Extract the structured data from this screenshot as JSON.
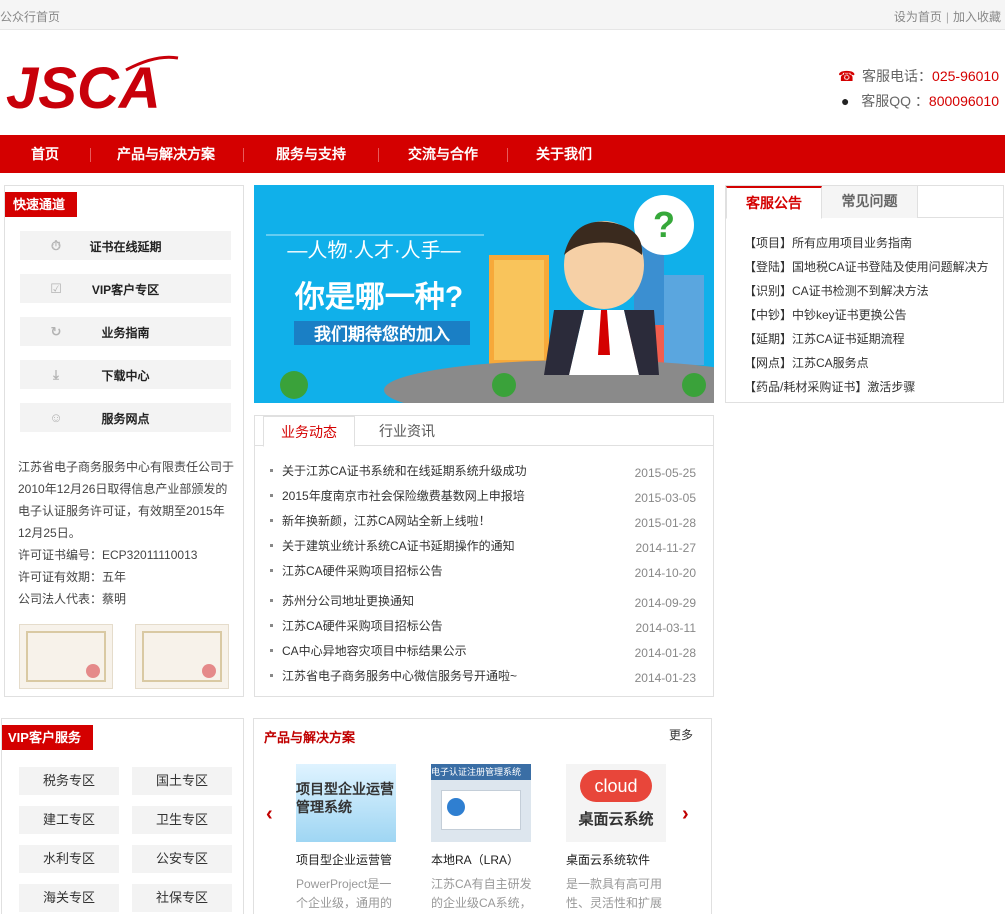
{
  "topbar": {
    "left": "公众行首页",
    "set_home": "设为首页",
    "separator": "|",
    "favorite": "加入收藏"
  },
  "logo": {
    "text": "JSCA"
  },
  "contact": {
    "phone_label": "客服电话：",
    "phone": "025-96010",
    "qq_label": "客服QQ ：",
    "qq": "800096010"
  },
  "nav": [
    "首页",
    "产品与解决方案",
    "服务与支持",
    "交流与合作",
    "关于我们"
  ],
  "quick": {
    "title": "快速通道",
    "items": [
      {
        "label": "证书在线延期",
        "icon": "stopwatch-icon"
      },
      {
        "label": "VIP客户专区",
        "icon": "check-icon"
      },
      {
        "label": "业务指南",
        "icon": "refresh-icon"
      },
      {
        "label": "下载中心",
        "icon": "download-icon"
      },
      {
        "label": "服务网点",
        "icon": "user-icon"
      }
    ],
    "intro": [
      "江苏省电子商务服务中心有限责任公司于2010年12月26日取得信息产业部颁发的电子认证服务许可证，有效期至2015年12月25日。",
      "许可证书编号：ECP32011110013",
      "许可证有效期：五年",
      "公司法人代表：蔡明"
    ]
  },
  "banner": {
    "line1": "—人物·人才·人手—",
    "line2": "你是哪一种?",
    "line3": "我们期待您的加入",
    "qmark": "?"
  },
  "news": {
    "tabs": [
      "业务动态",
      "行业资讯"
    ],
    "items": [
      {
        "title": "关于江苏CA证书系统和在线延期系统升级成功",
        "date": "2015-05-25"
      },
      {
        "title": "2015年度南京市社会保险缴费基数网上申报培",
        "date": "2015-03-05"
      },
      {
        "title": "新年换新颜，江苏CA网站全新上线啦！",
        "date": "2015-01-28"
      },
      {
        "title": "关于建筑业统计系统CA证书延期操作的通知",
        "date": "2014-11-27"
      },
      {
        "title": "江苏CA硬件采购项目招标公告",
        "date": "2014-10-20"
      },
      {
        "title": "苏州分公司地址更换通知",
        "date": "2014-09-29"
      },
      {
        "title": "江苏CA硬件采购项目招标公告",
        "date": "2014-03-11"
      },
      {
        "title": "CA中心异地容灾项目中标结果公示",
        "date": "2014-01-28"
      },
      {
        "title": "江苏省电子商务服务中心微信服务号开通啦~",
        "date": "2014-01-23"
      }
    ]
  },
  "notice": {
    "tabs": [
      "客服公告",
      "常见问题"
    ],
    "items": [
      "【项目】所有应用项目业务指南",
      "【登陆】国地税CA证书登陆及使用问题解决方",
      "【识别】CA证书检测不到解决方法",
      "【中钞】中钞key证书更换公告",
      "【延期】江苏CA证书延期流程",
      "【网点】江苏CA服务点",
      "【药品/耗材采购证书】激活步骤"
    ]
  },
  "vip": {
    "title": "VIP客户服务",
    "items": [
      "税务专区",
      "国土专区",
      "建工专区",
      "卫生专区",
      "水利专区",
      "公安专区",
      "海关专区",
      "社保专区"
    ]
  },
  "products": {
    "title": "产品与解决方案",
    "more": "更多",
    "prev": "‹",
    "next": "›",
    "items": [
      {
        "name": "项目型企业运营管",
        "desc": "PowerProject是一个企业级，通用的",
        "img_text": "项目型企业运营管理系统"
      },
      {
        "name": "本地RA（LRA）",
        "desc": "江苏CA有自主研发的企业级CA系统，",
        "img_text": "电子认证注册管理系统"
      },
      {
        "name": "桌面云系统软件",
        "desc": "是一款具有高可用性、灵活性和扩展",
        "img_text": "cloud",
        "img_text2": "桌面云系统"
      }
    ]
  },
  "colors": {
    "brand_red": "#d40000",
    "banner_blue": "#10b0ea"
  }
}
